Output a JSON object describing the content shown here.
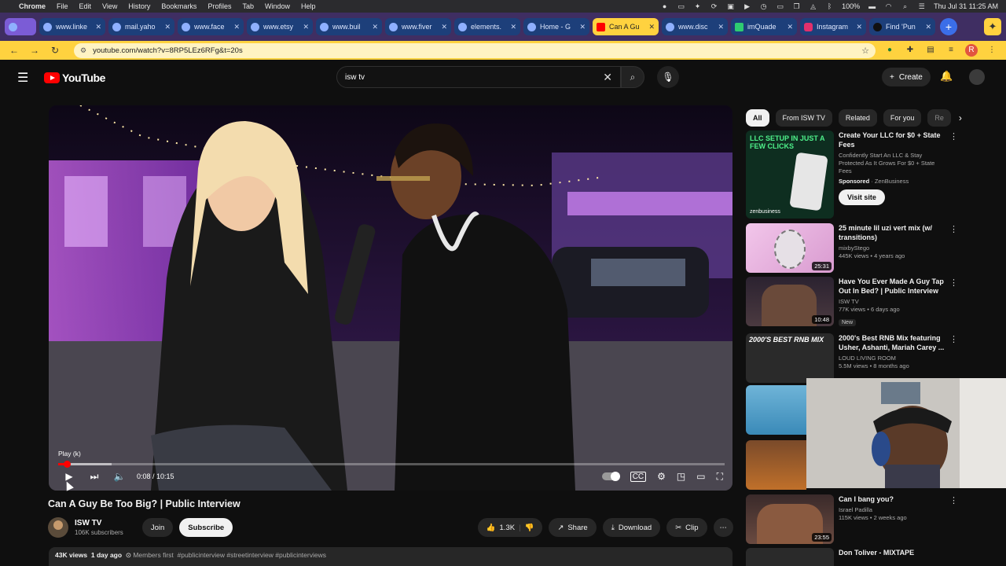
{
  "menubar": {
    "apple": "",
    "app": "Chrome",
    "items": [
      "File",
      "Edit",
      "View",
      "History",
      "Bookmarks",
      "Profiles",
      "Tab",
      "Window",
      "Help"
    ],
    "battery": "100%",
    "clock": "Thu Jul 31  11:25 AM"
  },
  "tabs": [
    {
      "label": "www.linke"
    },
    {
      "label": "mail.yaho"
    },
    {
      "label": "www.face"
    },
    {
      "label": "www.etsy"
    },
    {
      "label": "www.buil"
    },
    {
      "label": "www.fiver"
    },
    {
      "label": "elements."
    },
    {
      "label": "Home - G"
    },
    {
      "label": "Can A Gu"
    },
    {
      "label": "www.disc"
    },
    {
      "label": "imQuade"
    },
    {
      "label": "Instagram"
    },
    {
      "label": "Find 'Pun"
    }
  ],
  "address": {
    "url": "youtube.com/watch?v=8RP5LEz6RFg&t=20s"
  },
  "youtube": {
    "logo": "YouTube",
    "search_value": "isw tv",
    "create_label": "Create"
  },
  "player": {
    "tooltip": "Play (k)",
    "current_time": "0:08",
    "duration": "10:15",
    "time_display": "0:08 / 10:15",
    "progress_fraction": 0.013,
    "loaded_fraction": 0.08
  },
  "video": {
    "title": "Can A Guy Be Too Big? | Public Interview",
    "channel": "ISW TV",
    "subscribers": "106K subscribers",
    "join_label": "Join",
    "subscribe_label": "Subscribe",
    "likes": "1.3K",
    "share_label": "Share",
    "download_label": "Download",
    "clip_label": "Clip",
    "views": "43K views",
    "age": "1 day ago",
    "members": "Members first",
    "tags": "#publicinterview #streetinterview #publicinterviews"
  },
  "chips": [
    "All",
    "From ISW TV",
    "Related",
    "For you",
    "Re"
  ],
  "sidebar": {
    "ad": {
      "thumb_text": "LLC SETUP IN JUST A FEW CLICKS",
      "thumb_brand": "zenbusiness",
      "title": "Create Your LLC for $0 + State Fees",
      "desc": "Confidently Start An LLC & Stay Protected As It Grows For $0 + State Fees",
      "sponsored": "Sponsored",
      "advertiser": "ZenBusiness",
      "cta": "Visit site"
    },
    "recs": [
      {
        "title": "25 minute lil uzi vert mix (w/ transitions)",
        "channel": "mixbyStego",
        "meta": "445K views • 4 years ago",
        "duration": "25:31"
      },
      {
        "title": "Have You Ever Made A Guy Tap Out In Bed? | Public Interview",
        "channel": "ISW TV",
        "meta": "77K views • 6 days ago",
        "duration": "10:48",
        "badge": "New"
      },
      {
        "title": "2000's Best RNB Mix featuring Usher, Ashanti, Mariah Carey ...",
        "channel": "LOUD LIVING ROOM",
        "meta": "5.5M views • 8 months ago",
        "duration": "",
        "thumb_text": "2000'S BEST RNB MIX"
      },
      {
        "title": "Can I bang you?",
        "channel": "Israel Padilla",
        "meta": "115K views • 2 weeks ago",
        "duration": "23:55"
      },
      {
        "title": "Don Toliver - MIXTAPE",
        "channel": "",
        "meta": "",
        "duration": ""
      }
    ]
  },
  "colors": {
    "accent": "#ff0000",
    "toolbar": "#ffd23f",
    "background": "#0f0f0f"
  }
}
